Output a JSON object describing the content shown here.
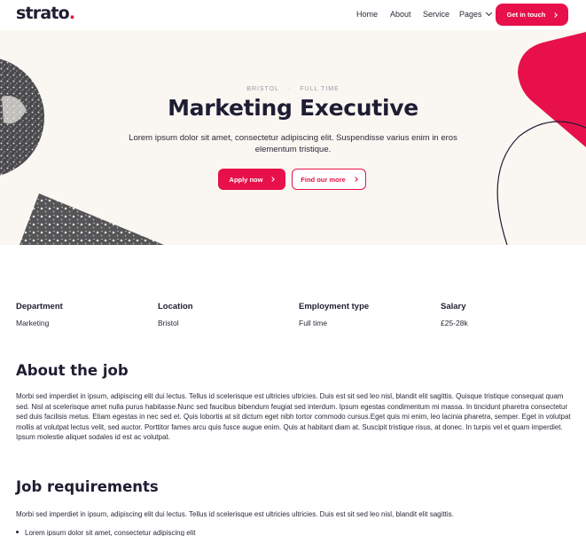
{
  "brand": {
    "logo_text": "strato",
    "logo_dot": ".",
    "accent_color": "#e8104a",
    "text_color": "#1f1d33",
    "hero_bg": "#faf7f2"
  },
  "nav": {
    "items": [
      {
        "label": "Home"
      },
      {
        "label": "About"
      },
      {
        "label": "Service"
      },
      {
        "label": "Pages",
        "icon": "chevron-down-icon"
      }
    ],
    "cta_label": "Get in touch",
    "cta_icon": "chevron-right-icon"
  },
  "hero": {
    "location": "BRISTOL",
    "separator": "·",
    "employment": "FULL TIME",
    "title": "Marketing Executive",
    "description": "Lorem ipsum dolor sit amet, consectetur adipiscing elit. Suspendisse varius enim in eros elementum tristique.",
    "apply_label": "Apply now",
    "more_label": "Find our more"
  },
  "details": [
    {
      "label": "Department",
      "value": "Marketing"
    },
    {
      "label": "Location",
      "value": "Bristol"
    },
    {
      "label": "Employment type",
      "value": "Full time"
    },
    {
      "label": "Salary",
      "value": "£25-28k"
    }
  ],
  "about": {
    "title": "About the job",
    "body": "Morbi sed imperdiet in ipsum, adipiscing elit dui lectus. Tellus id scelerisque est ultricies ultricies. Duis est sit sed leo nisl, blandit elit sagittis. Quisque tristique consequat quam sed. Nisl at scelerisque amet nulla purus habitasse.Nunc sed faucibus bibendum feugiat sed interdum. Ipsum egestas condimentum mi massa. In tincidunt pharetra consectetur sed duis facilisis metus. Etiam egestas in nec sed et. Quis lobortis at sit dictum eget nibh tortor commodo cursus.Eget quis mi enim, leo lacinia pharetra, semper. Eget in volutpat mollis at volutpat lectus velit, sed auctor. Porttitor fames arcu quis fusce augue enim. Quis at habitant diam at. Suscipit tristique risus, at donec. In turpis vel et quam imperdiet. Ipsum molestie aliquet sodales id est ac volutpat."
  },
  "requirements": {
    "title": "Job requirements",
    "body": "Morbi sed imperdiet in ipsum, adipiscing elit dui lectus. Tellus id scelerisque est ultricies ultricies. Duis est sit sed leo nisl, blandit elit sagittis.",
    "items": [
      "Lorem ipsum dolor sit amet, consectetur adipiscing elit"
    ]
  }
}
